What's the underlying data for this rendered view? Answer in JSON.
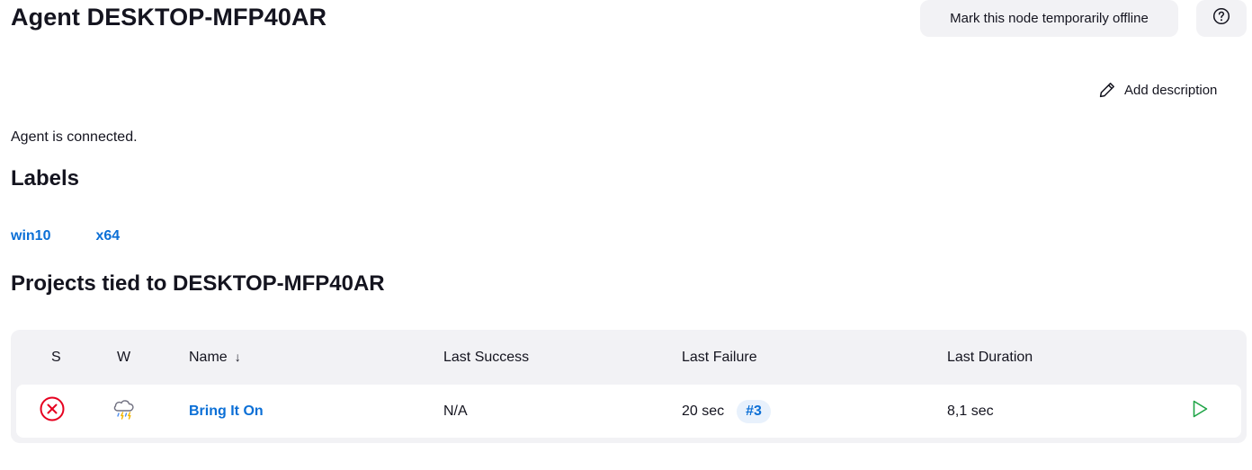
{
  "header": {
    "title": "Agent DESKTOP-MFP40AR",
    "offline_button": "Mark this node temporarily offline",
    "help_icon": "question-circle-icon"
  },
  "description": {
    "add_label": "Add description",
    "icon": "pencil-icon"
  },
  "status": {
    "text": "Agent is connected."
  },
  "labels": {
    "heading": "Labels",
    "items": [
      "win10",
      "x64"
    ]
  },
  "projects": {
    "heading": "Projects tied to DESKTOP-MFP40AR",
    "columns": {
      "s": "S",
      "w": "W",
      "name": "Name",
      "name_sort": "↓",
      "last_success": "Last Success",
      "last_failure": "Last Failure",
      "last_duration": "Last Duration"
    },
    "rows": [
      {
        "status_icon": "failed-x-circle-icon",
        "status_color": "#e6001f",
        "weather_icon": "thunderstorm-icon",
        "name": "Bring It On",
        "last_success": "N/A",
        "last_failure": "20 sec",
        "last_failure_build": "#3",
        "last_duration": "8,1 sec",
        "run_icon": "play-icon",
        "run_color": "#1ea446"
      }
    ]
  },
  "colors": {
    "link": "#0b6fd6",
    "button_bg": "#f2f2f5",
    "table_bg": "#f2f2f5"
  }
}
